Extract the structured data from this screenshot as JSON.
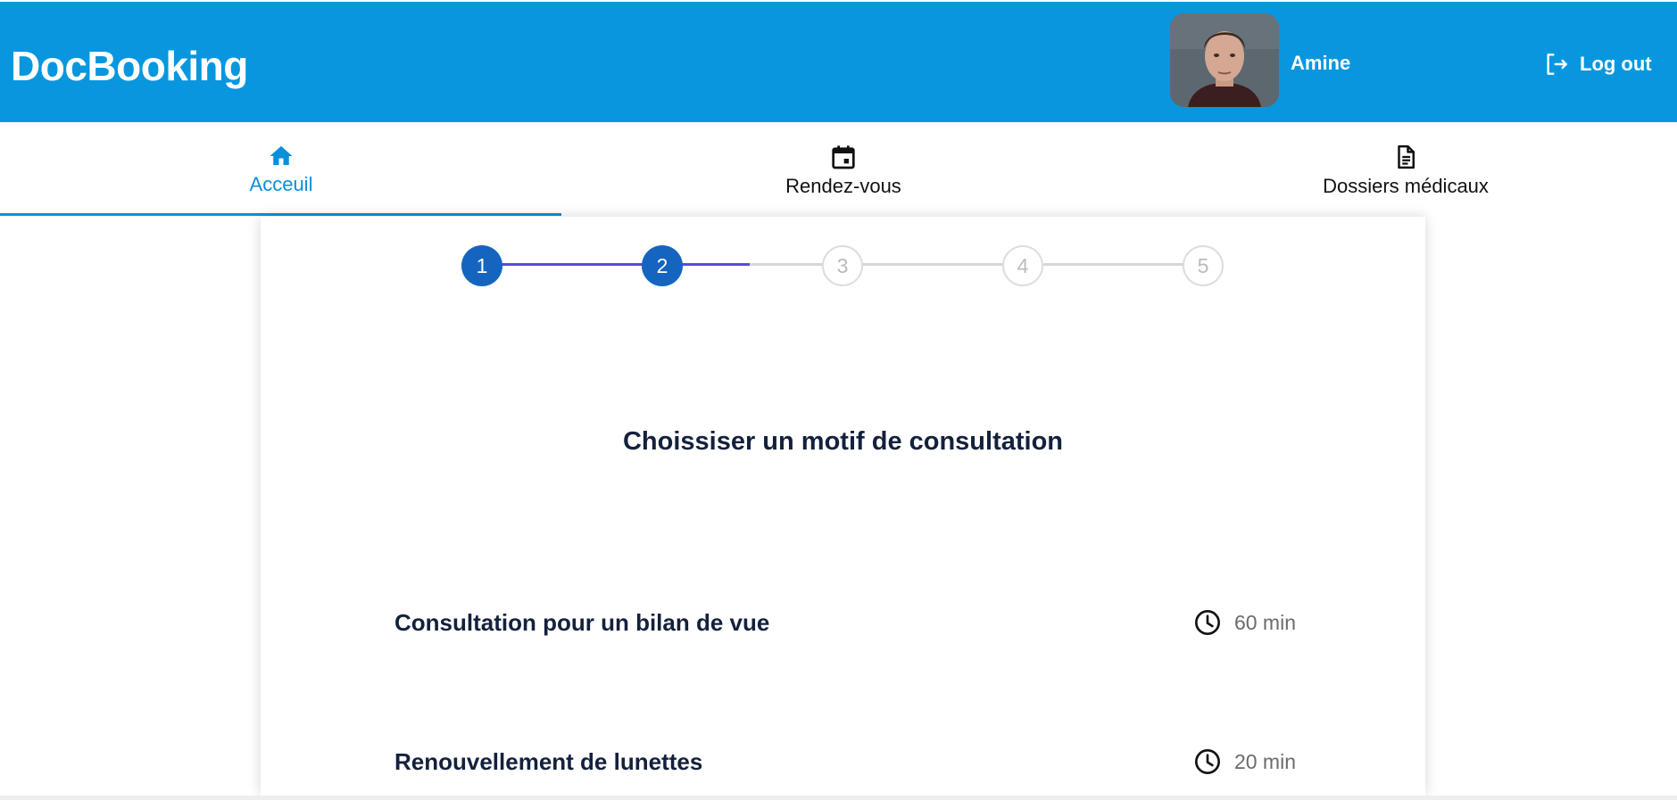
{
  "app": {
    "brand": "DocBooking"
  },
  "user": {
    "name": "Amine"
  },
  "header": {
    "logout_label": "Log out"
  },
  "tabs": [
    {
      "label": "Acceuil",
      "icon": "home-icon",
      "active": true
    },
    {
      "label": "Rendez-vous",
      "icon": "calendar-icon",
      "active": false
    },
    {
      "label": "Dossiers médicaux",
      "icon": "document-icon",
      "active": false
    }
  ],
  "stepper": {
    "steps": [
      "1",
      "2",
      "3",
      "4",
      "5"
    ],
    "current_step": 2,
    "colors": {
      "done": "#1565c0",
      "line_done": "#5b4bdb",
      "line_todo": "#d6d6d6"
    }
  },
  "main": {
    "title": "Choissiser un motif de consultation",
    "motifs": [
      {
        "label": "Consultation pour un bilan de vue",
        "duration": "60 min",
        "icon": "clock-icon"
      },
      {
        "label": "Renouvellement de lunettes",
        "duration": "20 min",
        "icon": "clock-icon"
      }
    ]
  },
  "colors": {
    "header_bg": "#0897de",
    "accent": "#0a8fd8",
    "title_text": "#14213d"
  }
}
